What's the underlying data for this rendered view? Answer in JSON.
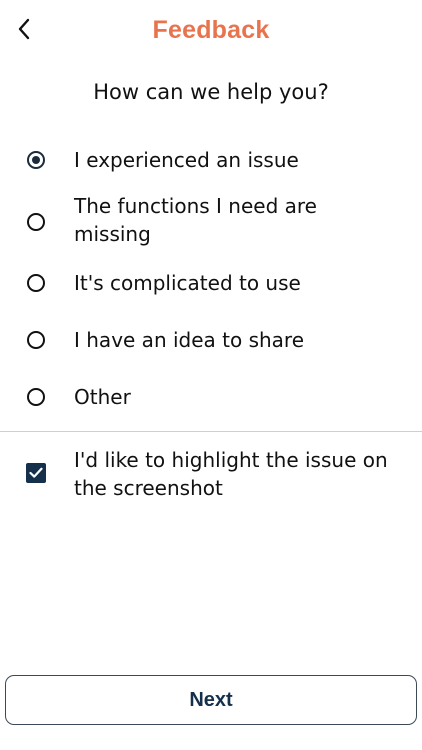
{
  "header": {
    "title": "Feedback",
    "back_icon": "chevron-left-icon"
  },
  "question": "How can we help you?",
  "options": [
    {
      "label": "I experienced an issue",
      "selected": true
    },
    {
      "label": "The functions I need are missing",
      "selected": false
    },
    {
      "label": "It's complicated to use",
      "selected": false
    },
    {
      "label": "I have an idea to share",
      "selected": false
    },
    {
      "label": "Other",
      "selected": false
    }
  ],
  "highlight": {
    "label": "I'd like to highlight the issue on the screenshot",
    "checked": true
  },
  "footer": {
    "next_label": "Next"
  },
  "colors": {
    "accent": "#e8744e",
    "primary": "#15304b"
  }
}
